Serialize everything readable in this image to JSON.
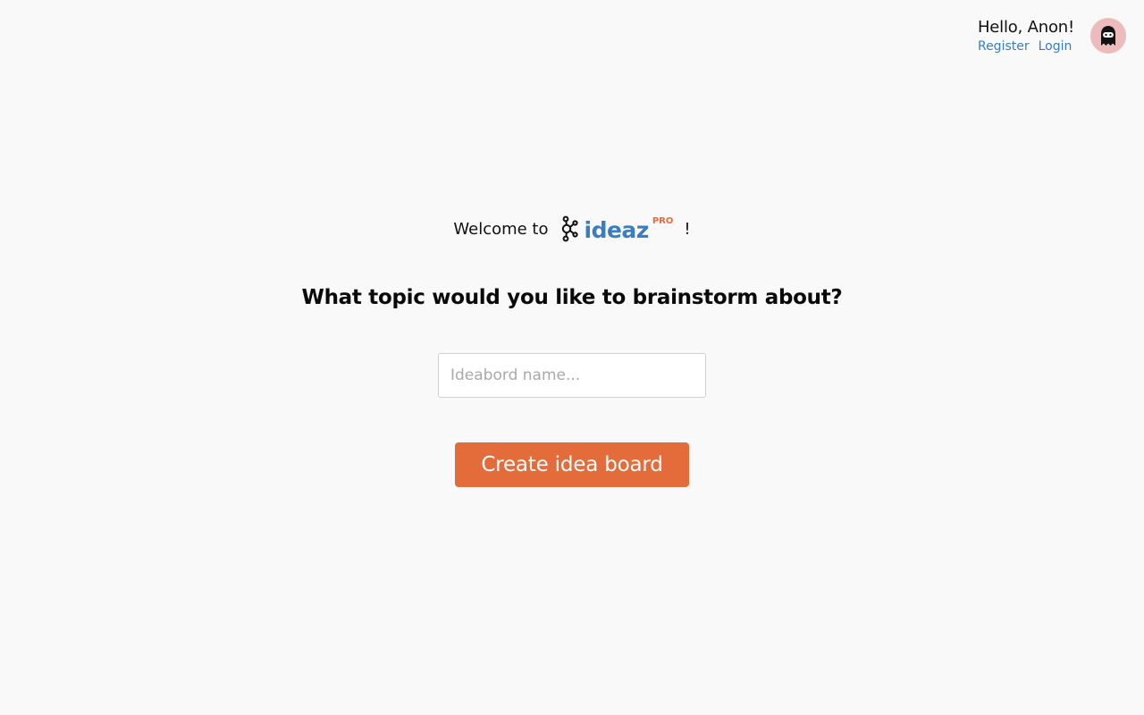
{
  "header": {
    "greeting": "Hello, Anon!",
    "register_label": "Register",
    "login_label": "Login",
    "avatar_icon": "ninja-avatar-icon",
    "avatar_color": "#ecbcbc"
  },
  "welcome": {
    "prefix": "Welcome to",
    "logo_icon": "molecule-icon",
    "logo_word": "ideaz",
    "logo_badge": "PRO",
    "suffix": "!"
  },
  "main": {
    "headline": "What topic would you like to brainstorm about?",
    "input_placeholder": "Ideabord name...",
    "input_value": "",
    "create_button_label": "Create idea board"
  },
  "colors": {
    "accent_orange": "#e46c3a",
    "link_blue": "#3a7ec2",
    "background": "#f9f9f9"
  }
}
